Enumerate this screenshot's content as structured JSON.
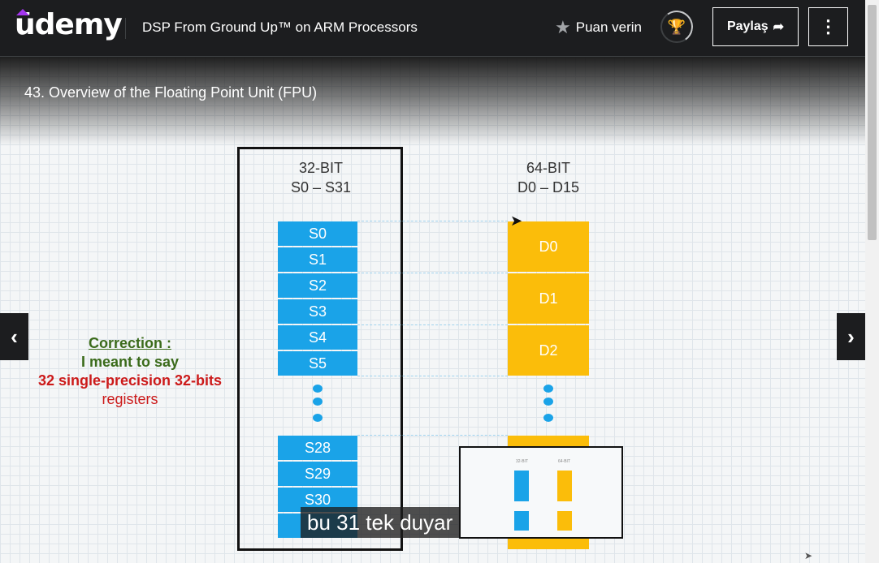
{
  "header": {
    "logo": "ūdemy",
    "course_title": "DSP From Ground Up™ on ARM Processors",
    "rate_label": "Puan verin",
    "share_label": "Paylaş",
    "more_icon": "⋮"
  },
  "video": {
    "lecture_title": "43. Overview of the Floating Point Unit (FPU)",
    "slide": {
      "left_header_line1": "32-BIT",
      "left_header_line2": "S0 – S31",
      "right_header_line1": "64-BIT",
      "right_header_line2": "D0 – D15",
      "s_registers_top": [
        "S0",
        "S1",
        "S2",
        "S3",
        "S4",
        "S5"
      ],
      "s_registers_bottom": [
        "S28",
        "S29",
        "S30"
      ],
      "d_registers": [
        "D0",
        "D1",
        "D2"
      ],
      "correction": {
        "line1": "Correction :",
        "line2": "I meant to say",
        "line3": "32 single-precision 32-bits",
        "line4": "registers"
      }
    },
    "caption": "bu 31 tek duyar",
    "prev_icon": "chevron-left-icon",
    "next_icon": "chevron-right-icon"
  },
  "colors": {
    "background": "#1c1d1f",
    "s_register": "#1aa3e8",
    "d_register": "#fbbd0a",
    "brand": "#a435f0"
  }
}
